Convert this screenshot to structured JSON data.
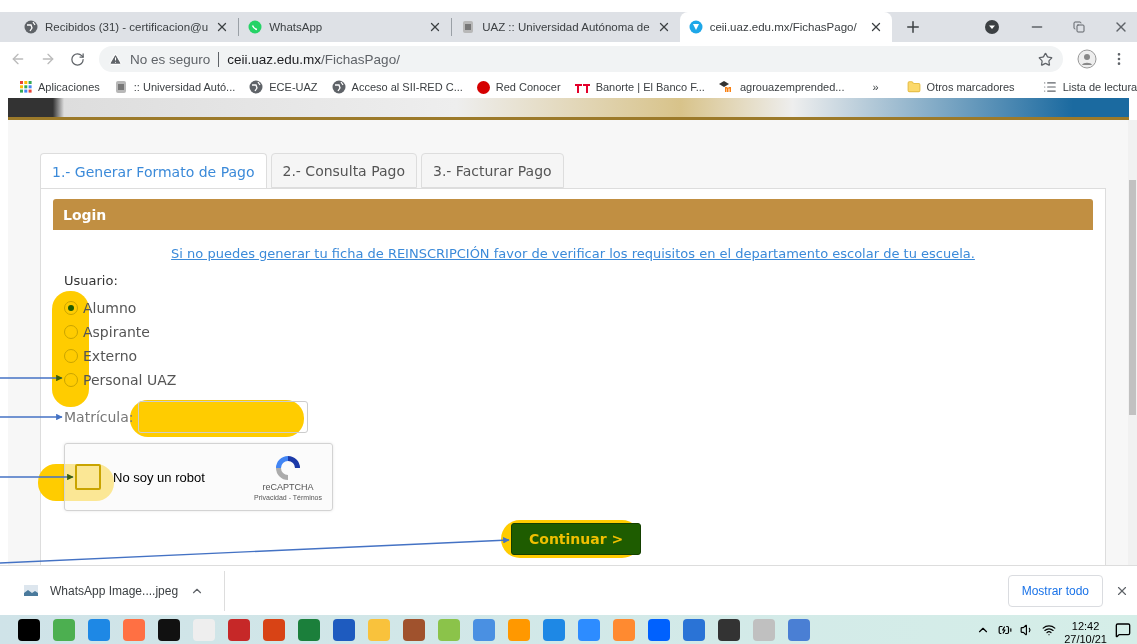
{
  "browser_tabs": [
    {
      "title": "Recibidos (31) - certificacion@u",
      "kind": "globe",
      "selected": false
    },
    {
      "title": "WhatsApp",
      "kind": "chat",
      "selected": false
    },
    {
      "title": "UAZ :: Universidad Autónoma de",
      "kind": "crest",
      "selected": false
    },
    {
      "title": "ceii.uaz.edu.mx/FichasPago/",
      "kind": "site",
      "selected": true
    }
  ],
  "address_bar": {
    "warning": "No es seguro",
    "host": "ceii.uaz.edu.mx",
    "path": "/FichasPago/"
  },
  "bookmarks": [
    {
      "label": "Aplicaciones",
      "kind": "apps"
    },
    {
      "label": ":: Universidad Autó...",
      "kind": "crest"
    },
    {
      "label": "ECE-UAZ",
      "kind": "globe"
    },
    {
      "label": "Acceso al SII-RED C...",
      "kind": "globe"
    },
    {
      "label": "Red Conocer",
      "kind": "dot"
    },
    {
      "label": "Banorte | El Banco F...",
      "kind": "bank"
    },
    {
      "label": "agrouazemprended...",
      "kind": "cap"
    }
  ],
  "bookmarks_more": "»",
  "other_bookmarks": "Otros marcadores",
  "reading_list": "Lista de lectura",
  "page_tabs": [
    {
      "label": "1.- Generar Formato de Pago",
      "selected": true
    },
    {
      "label": "2.- Consulta Pago",
      "selected": false
    },
    {
      "label": "3.- Facturar Pago",
      "selected": false
    }
  ],
  "panel": {
    "title": "Login",
    "notice_link": "Si no puedes generar tu ficha de REINSCRIPCIÓN favor de verificar los requisitos en el departamento escolar de tu escuela.",
    "user_label": "Usuario:",
    "user_options": [
      {
        "label": "Alumno",
        "selected": true
      },
      {
        "label": "Aspirante",
        "selected": false
      },
      {
        "label": "Externo",
        "selected": false
      },
      {
        "label": "Personal UAZ",
        "selected": false
      }
    ],
    "matricula_label": "Matrícula:",
    "captcha": {
      "label": "No soy un robot",
      "checked": false,
      "brand": "reCAPTCHA",
      "terms": "Privacidad - Términos"
    },
    "submit": "Continuar >"
  },
  "download_bar": {
    "file": "WhatsApp Image....jpeg",
    "show_all": "Mostrar todo"
  },
  "taskbar": {
    "time": "12:42",
    "date": "27/10/21"
  }
}
